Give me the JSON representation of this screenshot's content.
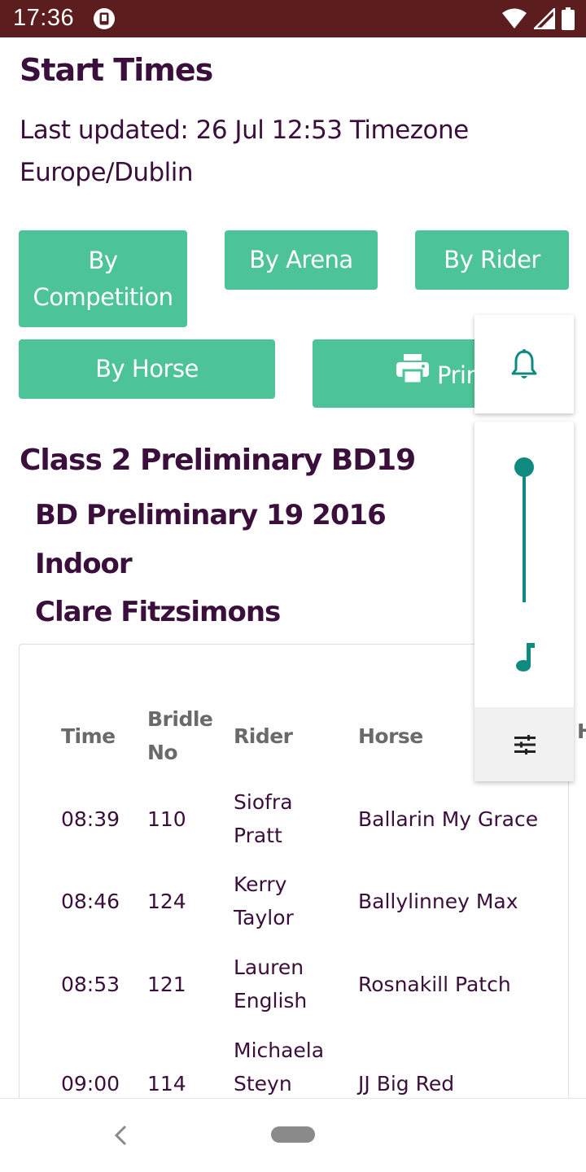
{
  "status_bar": {
    "time": "17:36",
    "icons": [
      "app-notification-icon",
      "wifi-icon",
      "signal-icon",
      "battery-icon"
    ]
  },
  "page": {
    "title": "Start Times",
    "last_updated": "Last updated: 26 Jul 12:53 Timezone Europe/Dublin"
  },
  "buttons": {
    "by_competition": "By Competition",
    "by_arena": "By Arena",
    "by_rider": "By Rider",
    "by_horse": "By Horse",
    "print": "Print"
  },
  "class": {
    "title": "Class 2 Preliminary BD19",
    "test": "BD Preliminary 19 2016",
    "arena": "Indoor",
    "judge": "Clare Fitzsimons"
  },
  "table": {
    "headers": {
      "time": "Time",
      "bridle_no": "Bridle No",
      "rider": "Rider",
      "horse": "Horse",
      "next": "H"
    },
    "rows": [
      {
        "time": "08:39",
        "bridle_no": "110",
        "rider": "Siofra Pratt",
        "horse": "Ballarin My Grace"
      },
      {
        "time": "08:46",
        "bridle_no": "124",
        "rider": "Kerry Taylor",
        "horse": "Ballylinney Max"
      },
      {
        "time": "08:53",
        "bridle_no": "121",
        "rider": "Lauren English",
        "horse": "Rosnakill Patch"
      },
      {
        "time": "09:00",
        "bridle_no": "114",
        "rider": "Michaela Steyn",
        "horse": "JJ Big Red"
      }
    ]
  },
  "volume_panel": {
    "icons": [
      "bell-icon",
      "music-note-icon",
      "equalizer-settings-icon"
    ],
    "level": 1.0
  },
  "colors": {
    "status_bar": "#5b1d1d",
    "accent_button": "#4cc497",
    "title_text": "#3b0f3b",
    "slider": "#0f8a7e"
  }
}
